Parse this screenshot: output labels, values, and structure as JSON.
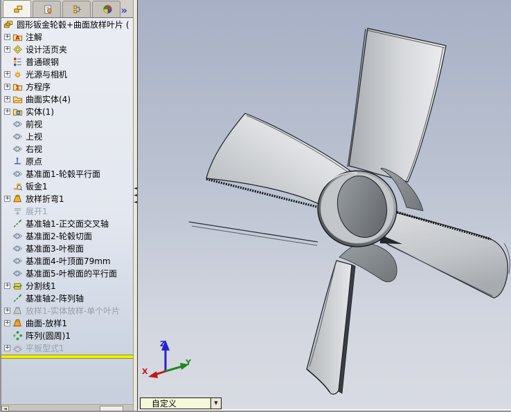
{
  "panel": {
    "tabs": [
      {
        "name": "featuremanager",
        "icon": "tab-feature",
        "selected": true
      },
      {
        "name": "propertymanager",
        "icon": "tab-property",
        "selected": false
      },
      {
        "name": "configurationmanager",
        "icon": "tab-config",
        "selected": false
      },
      {
        "name": "dimxpertmanager",
        "icon": "tab-wheel",
        "selected": false
      }
    ],
    "overflow_button": "»",
    "splitter_arrow": "◄",
    "scrollbar": {
      "left_arrow": "◄"
    },
    "tree": {
      "expand_glyph": "+",
      "root": {
        "label": "圆形钣金轮毂+曲面放样叶片 (",
        "icon": "part"
      },
      "items": [
        {
          "label": "注解",
          "icon": "annotations",
          "expand": true
        },
        {
          "label": "设计活页夹",
          "icon": "design-binder",
          "expand": true
        },
        {
          "label": "普通碳钢",
          "icon": "material"
        },
        {
          "label": "光源与相机",
          "icon": "lights-cameras",
          "expand": true
        },
        {
          "label": "方程序",
          "icon": "equations",
          "expand": true
        },
        {
          "label": "曲面实体(4)",
          "icon": "surface-bodies",
          "expand": true
        },
        {
          "label": "实体(1)",
          "icon": "solid-bodies",
          "expand": true
        },
        {
          "label": "前视",
          "icon": "plane"
        },
        {
          "label": "上视",
          "icon": "plane"
        },
        {
          "label": "右视",
          "icon": "plane"
        },
        {
          "label": "原点",
          "icon": "origin"
        },
        {
          "label": "基准面1-轮毂平行面",
          "icon": "plane"
        },
        {
          "label": "钣金1",
          "icon": "sheet-metal"
        },
        {
          "label": "放样折弯1",
          "icon": "lofted-bend",
          "expand": true
        },
        {
          "label": "展开1",
          "icon": "flatten",
          "grayed": true
        },
        {
          "label": "基准轴1-正交面交叉轴",
          "icon": "axis"
        },
        {
          "label": "基准面2-轮毂切面",
          "icon": "plane"
        },
        {
          "label": "基准面3-叶根面",
          "icon": "plane"
        },
        {
          "label": "基准面4-叶顶面79mm",
          "icon": "plane"
        },
        {
          "label": "基准面5-叶根面的平行面",
          "icon": "plane"
        },
        {
          "label": "分割线1",
          "icon": "split-line",
          "expand": true
        },
        {
          "label": "基准轴2-阵列轴",
          "icon": "axis"
        },
        {
          "label": "放样1-实体放样-单个叶片",
          "icon": "loft-gray",
          "expand": true,
          "grayed": true
        },
        {
          "label": "曲面-放样1",
          "icon": "surface-loft",
          "expand": true
        },
        {
          "label": "阵列(圆周)1",
          "icon": "circular-pattern"
        },
        {
          "label": "平板型式1",
          "icon": "flat-pattern",
          "expand": true,
          "grayed": true
        }
      ]
    }
  },
  "viewport": {
    "scene_combo": {
      "value": "自定义",
      "arrow": "▼"
    },
    "triad": {
      "x_label": "X",
      "y_label": "Y",
      "z_label": "Z"
    }
  },
  "colors": {
    "rollback_bar": "#f2ee00",
    "triad_x": "#c01818",
    "triad_y": "#1a8a1a",
    "triad_z": "#2424cc",
    "viewport_top": "#a7b0c5",
    "viewport_bottom": "#d8dbe2",
    "model_gray": "#c9ccd0"
  }
}
